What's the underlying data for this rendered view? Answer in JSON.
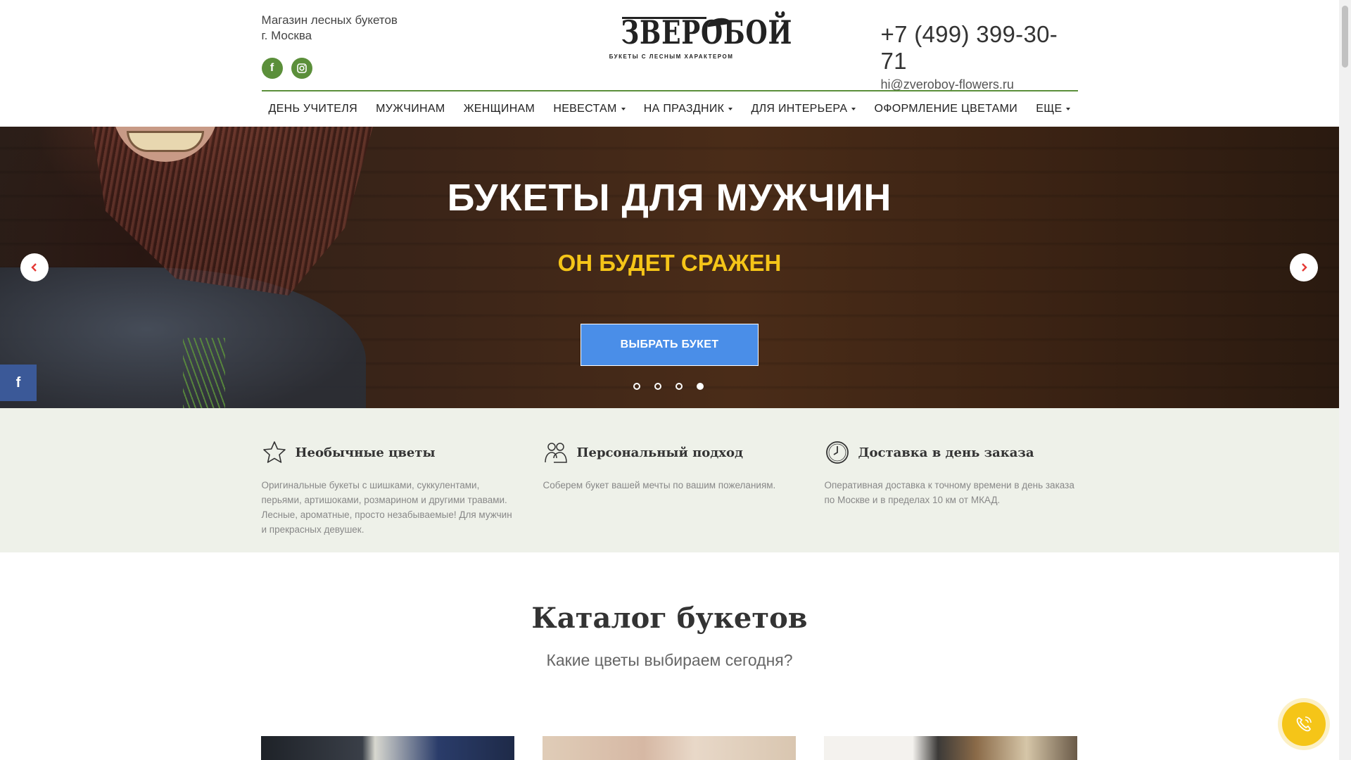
{
  "header": {
    "shop_line1": "Магазин лесных букетов",
    "shop_line2": "г. Москва",
    "logo_brand": "ЗВЕРОБОЙ",
    "logo_tagline": "БУКЕТЫ С ЛЕСНЫМ ХАРАКТЕРОМ",
    "phone": "+7 (499) 399-30-71",
    "email": "hi@zveroboy-flowers.ru",
    "socials": [
      {
        "icon": "facebook-icon",
        "glyph": "f"
      },
      {
        "icon": "instagram-icon"
      }
    ]
  },
  "nav": {
    "items": [
      {
        "label": "ДЕНЬ УЧИТЕЛЯ",
        "dropdown": false
      },
      {
        "label": "МУЖЧИНАМ",
        "dropdown": false
      },
      {
        "label": "ЖЕНЩИНАМ",
        "dropdown": false
      },
      {
        "label": "НЕВЕСТАМ",
        "dropdown": true
      },
      {
        "label": "НА ПРАЗДНИК",
        "dropdown": true
      },
      {
        "label": "ДЛЯ ИНТЕРЬЕРА",
        "dropdown": true
      },
      {
        "label": "ОФОРМЛЕНИЕ ЦВЕТАМИ",
        "dropdown": false
      },
      {
        "label": "ЕЩЕ",
        "dropdown": true
      }
    ]
  },
  "hero": {
    "title": "БУКЕТЫ ДЛЯ МУЖЧИН",
    "subtitle": "ОН БУДЕТ СРАЖЕН",
    "button_label": "ВЫБРАТЬ БУКЕТ",
    "slides_count": 4,
    "active_slide": 4,
    "fb_glyph": "f"
  },
  "features": [
    {
      "icon": "star-icon",
      "title": "Необычные цветы",
      "text": "Оригинальные букеты с шишками, суккулентами, перьями, артишоками, розмарином и другими травами. Лесные, ароматные, просто незабываемые! Для мужчин и прекрасных девушек."
    },
    {
      "icon": "people-icon",
      "title": "Персональный подход",
      "text": "Соберем букет вашей мечты по вашим пожеланиям."
    },
    {
      "icon": "clock-icon",
      "title": "Доставка в день заказа",
      "text": "Оперативная доставка к точному времени в день заказа по Москве и в пределах 10 км от МКАД."
    }
  ],
  "catalog": {
    "title": "Каталог букетов",
    "subtitle": "Какие цветы выбираем сегодня?"
  },
  "colors": {
    "accent_green": "#5b8f3a",
    "button_blue": "#4a8ee8",
    "hero_subtitle_yellow": "#f5c518",
    "call_button_yellow": "#f5c518",
    "facebook_blue": "#3b5998"
  }
}
